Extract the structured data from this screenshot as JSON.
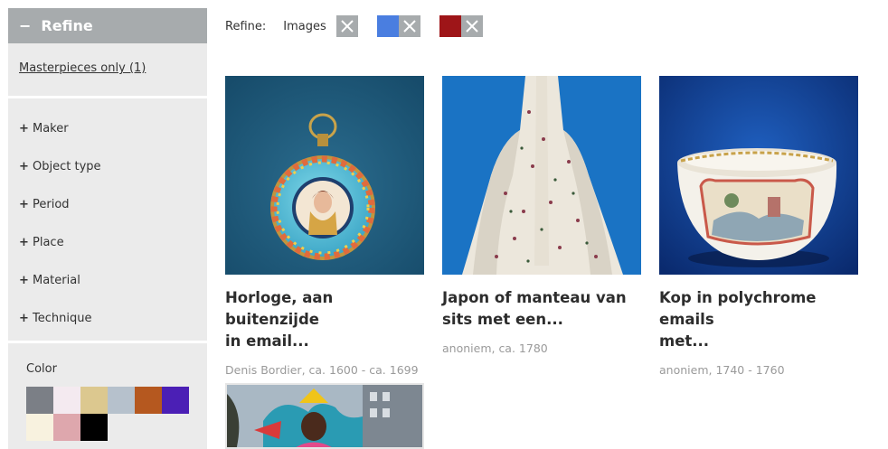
{
  "sidebar": {
    "refine_title": "Refine",
    "collapse_symbol": "−",
    "masterpieces_link": "Masterpieces only (1)",
    "facets": [
      {
        "label": "Maker"
      },
      {
        "label": "Object type"
      },
      {
        "label": "Period"
      },
      {
        "label": "Place"
      },
      {
        "label": "Material"
      },
      {
        "label": "Technique"
      }
    ],
    "color_title": "Color",
    "swatches": [
      "#7b7f86",
      "#f4eaf0",
      "#dcc88f",
      "#b6c1cc",
      "#b5581f",
      "#4b1fb5",
      "#f8f2df",
      "#dea7ad",
      "#000000"
    ]
  },
  "refine_bar": {
    "label": "Refine:",
    "type_chip": "Images",
    "color_chips": [
      "#4a7ee0",
      "#9e1518"
    ]
  },
  "results": [
    {
      "title_line1": "Horloge, aan buitenzijde",
      "title_line2": "in email...",
      "meta": "Denis Bordier, ca. 1600 - ca. 1699",
      "image": "watch-image"
    },
    {
      "title_line1": "Japon of manteau van",
      "title_line2": "sits met een...",
      "meta": "anoniem, ca. 1780",
      "image": "dress-image"
    },
    {
      "title_line1": "Kop in polychrome emails",
      "title_line2": "met...",
      "meta": "anoniem, 1740 - 1760",
      "image": "cup-image"
    }
  ]
}
